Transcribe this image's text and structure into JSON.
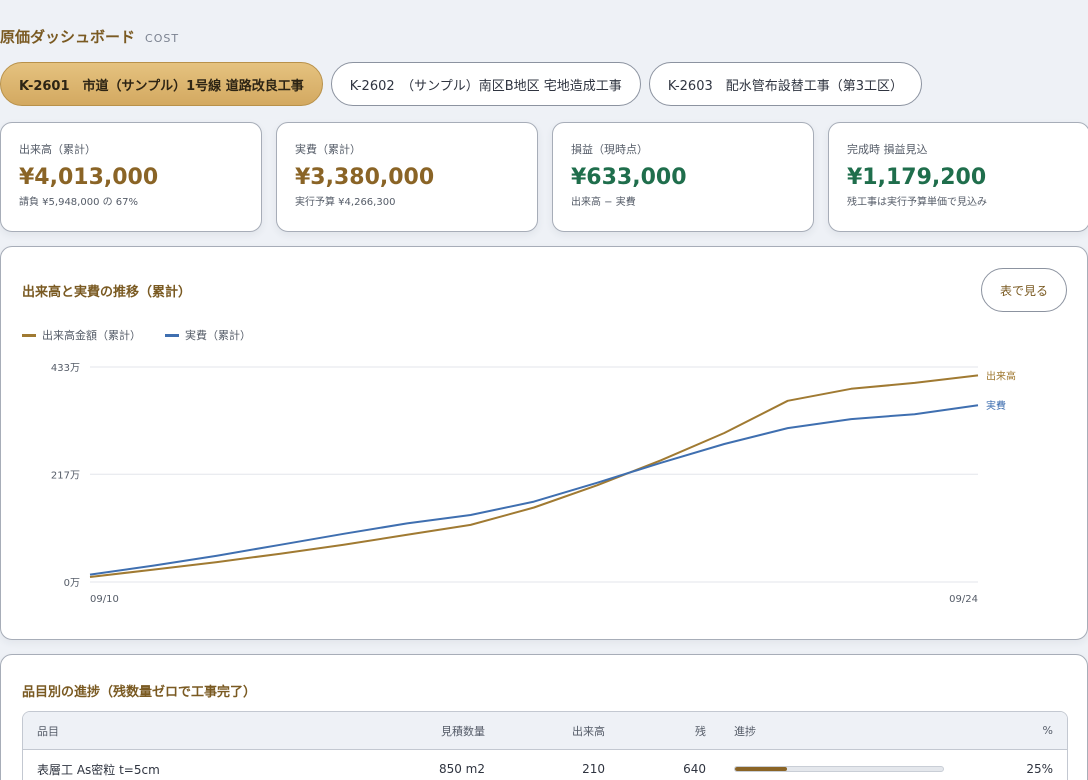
{
  "header": {
    "title": "原価ダッシュボード",
    "subtitle": "COST"
  },
  "tabs": [
    {
      "label": "K-2601　市道（サンプル）1号線 道路改良工事",
      "active": true
    },
    {
      "label": "K-2602　（サンプル）南区B地区 宅地造成工事",
      "active": false
    },
    {
      "label": "K-2603　配水管布設替工事（第3工区）",
      "active": false
    }
  ],
  "cards": [
    {
      "label": "出来高（累計）",
      "value": "¥4,013,000",
      "note": "請負 ¥5,948,000 の 67%",
      "tone": "gold"
    },
    {
      "label": "実費（累計）",
      "value": "¥3,380,000",
      "note": "実行予算 ¥4,266,300",
      "tone": "gold"
    },
    {
      "label": "損益（現時点）",
      "value": "¥633,000",
      "note": "出来高 − 実費",
      "tone": "green"
    },
    {
      "label": "完成時 損益見込",
      "value": "¥1,179,200",
      "note": "残工事は実行予算単価で見込み",
      "tone": "green"
    }
  ],
  "chart_panel": {
    "title": "出来高と実費の推移（累計）",
    "table_button": "表で見る"
  },
  "chart_data": {
    "type": "line",
    "x": [
      "09/10",
      "09/11",
      "09/12",
      "09/13",
      "09/14",
      "09/15",
      "09/16",
      "09/17",
      "09/18",
      "09/19",
      "09/20",
      "09/21",
      "09/22",
      "09/23",
      "09/24"
    ],
    "x_tick_labels": [
      "09/10",
      "09/24"
    ],
    "y_tick_labels": [
      "433万",
      "217万",
      "0万"
    ],
    "y_ticks": [
      433,
      217,
      0
    ],
    "ylim": [
      0,
      433
    ],
    "grid": true,
    "legend_placement": "top-left",
    "series": [
      {
        "name": "出来高金額（累計）",
        "end_label": "出来高",
        "color": "#a07a32",
        "values": [
          10,
          25,
          40,
          57,
          75,
          95,
          115,
          150,
          195,
          245,
          300,
          365,
          389,
          401,
          416
        ]
      },
      {
        "name": "実費（累計）",
        "end_label": "実費",
        "color": "#3f6fb0",
        "values": [
          15,
          33,
          53,
          75,
          97,
          118,
          135,
          162,
          200,
          240,
          278,
          310,
          328,
          338,
          356
        ]
      }
    ]
  },
  "progress_panel": {
    "title": "品目別の進捗（残数量ゼロで工事完了）",
    "columns": {
      "name": "品目",
      "qty": "見積数量",
      "done": "出来高",
      "rem": "残",
      "bar": "進捗",
      "pct": "%"
    },
    "rows": [
      {
        "name": "表層工 As密粒 t=5cm",
        "qty": "850 m2",
        "done": "210",
        "rem": "640",
        "progress": 0.25,
        "pct": "25%"
      }
    ]
  }
}
